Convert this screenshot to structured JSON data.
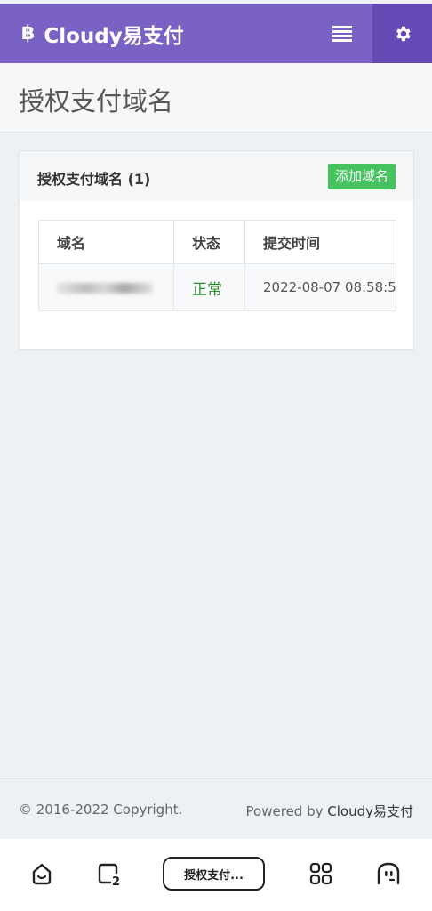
{
  "header": {
    "brand_icon": "bitcoin-icon",
    "brand": "Cloudy易支付",
    "menu_icon": "list-icon",
    "settings_icon": "gear-icon",
    "accent_color": "#7a62c5"
  },
  "page": {
    "title": "授权支付域名"
  },
  "panel": {
    "title": "授权支付域名 (1)",
    "add_button": "添加域名",
    "table": {
      "columns": [
        "域名",
        "状态",
        "提交时间"
      ],
      "rows": [
        {
          "domain": "",
          "status": "正常",
          "time": "2022-08-07 08:58:5"
        }
      ]
    }
  },
  "footer": {
    "copyright": "© 2016-2022 Copyright.",
    "powered_prefix": "Powered by ",
    "powered_brand": "Cloudy易支付"
  },
  "bottom_nav": {
    "home_icon": "home-icon",
    "tabs_icon": "tabs-count-icon",
    "tabs_count": "2",
    "current_tab": "授权支付...",
    "apps_icon": "apps-grid-icon",
    "profile_icon": "ghost-face-icon"
  }
}
